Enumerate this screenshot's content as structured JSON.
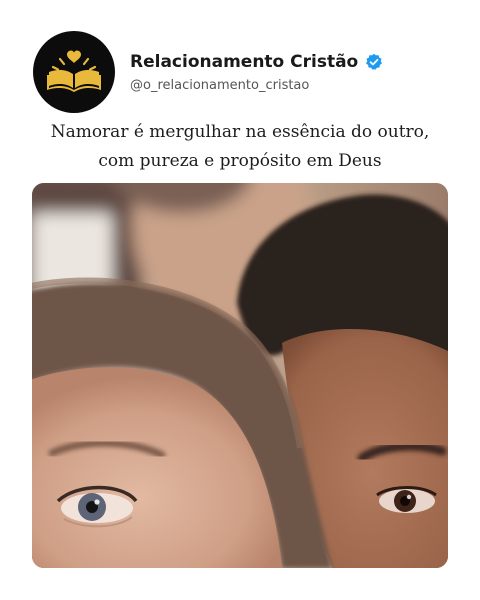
{
  "post": {
    "account_name": "Relacionamento Cristão",
    "handle": "@o_relacionamento_cristao",
    "verified": true,
    "caption_line_1": "Namorar é mergulhar na essência do outro,",
    "caption_line_2": "com pureza e propósito em Deus"
  },
  "icons": {
    "avatar": "open-book-with-heart-icon",
    "verified": "verified-badge-icon"
  },
  "colors": {
    "avatar_background": "#0c0c0c",
    "logo_gold": "#e8b93a",
    "verified_blue": "#1d9bf0",
    "caption_text": "#1d1d1d"
  }
}
